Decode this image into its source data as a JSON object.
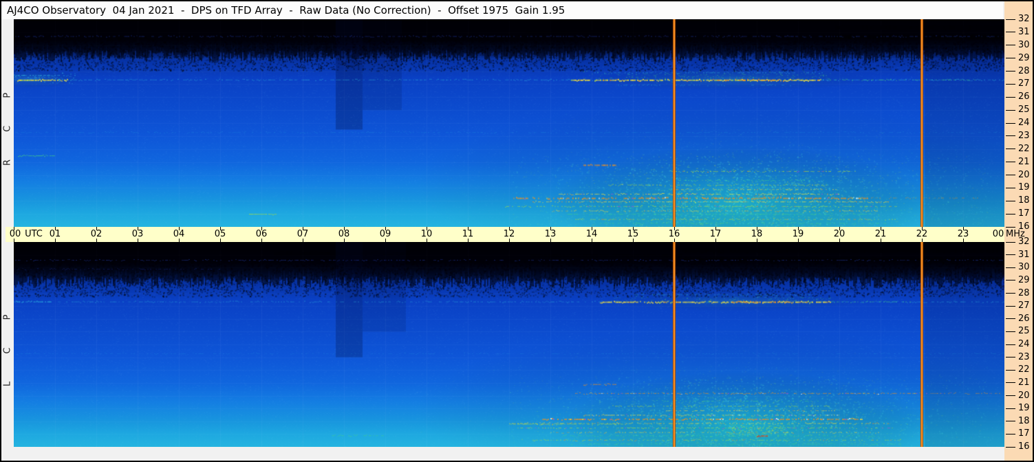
{
  "title": "AJ4CO Observatory  04 Jan 2021  -  DPS on TFD Array  -  Raw Data (No Correction)  -  Offset 1975  Gain 1.95",
  "time_axis": {
    "unit_label": "UTC",
    "right_unit": "MHz",
    "hours": [
      "00",
      "01",
      "02",
      "03",
      "04",
      "05",
      "06",
      "07",
      "08",
      "09",
      "10",
      "11",
      "12",
      "13",
      "14",
      "15",
      "16",
      "17",
      "18",
      "19",
      "20",
      "21",
      "22",
      "23",
      "00"
    ]
  },
  "freq_axis": {
    "unit": "MHz",
    "ticks": [
      32,
      31,
      30,
      29,
      28,
      27,
      26,
      25,
      24,
      23,
      22,
      21,
      20,
      19,
      18,
      17,
      16
    ]
  },
  "colors": {
    "chrome_bg": "#f1f1f1",
    "titlebar_bg": "#fcfcfc",
    "time_axis_bg": "#ffffc9",
    "freq_axis_bg": "#fbdab4",
    "border": "#000000",
    "marker_center": "#ff9726",
    "marker_edge": "#a34700"
  },
  "chart_data": {
    "type": "heatmap",
    "title": "AJ4CO Observatory 04 Jan 2021 - DPS on TFD Array - Raw Data (No Correction)",
    "date": "04 Jan 2021",
    "offset": 1975,
    "gain": 1.95,
    "x_axis": {
      "label": "UTC",
      "range_hours": [
        0,
        24
      ],
      "tick_interval_hours": 1
    },
    "y_axis": {
      "label": "MHz",
      "range_mhz": [
        16,
        32
      ],
      "tick_interval_mhz": 1,
      "direction": "up"
    },
    "marker_lines": {
      "times_utc": [
        16,
        22
      ]
    },
    "palette": {
      "blue": "#2847d8",
      "cyan": "#38d8e8",
      "green": "#48dc78",
      "yellowgreen": "#aade3c",
      "yellow": "#f0dc3a",
      "orange": "#f09020",
      "red": "#e03818",
      "magenta": "#b84cc8",
      "white": "#f8f8f0"
    },
    "base_gradient": [
      [
        32,
        "#000002"
      ],
      [
        30.4,
        "#000210"
      ],
      [
        29.7,
        "#031448"
      ],
      [
        28.9,
        "#0631a4"
      ],
      [
        27.5,
        "#0a40c4"
      ],
      [
        25,
        "#0c4ccf"
      ],
      [
        23,
        "#0e56d8"
      ],
      [
        21,
        "#1066de"
      ],
      [
        19.5,
        "#147ee2"
      ],
      [
        18,
        "#1896de"
      ],
      [
        17,
        "#1ea8e0"
      ],
      [
        16,
        "#25b4e0"
      ]
    ],
    "panels": [
      {
        "polarization": "RCP",
        "label": "R C P",
        "dark_f": 29.15,
        "noise_center": {
          "t": 17.6,
          "f": 18.2,
          "rt": 3.6,
          "rf": 3.4
        },
        "band_boost": {
          "t0": 12,
          "t1": 23.6,
          "fmax": 21.5,
          "w": 0.16
        },
        "glows": [
          {
            "t": 17.6,
            "f": 17.9,
            "rt": 4.6,
            "rf": 4.4,
            "c": "rgba(40,225,170,0.30)"
          },
          {
            "t": 17.3,
            "f": 19.2,
            "rt": 7.6,
            "rf": 6.5,
            "c": "rgba(25,185,215,0.17)"
          },
          {
            "t": 17.4,
            "f": 27.4,
            "rt": 3.6,
            "rf": 0.9,
            "c": "rgba(70,215,130,0.18)"
          },
          {
            "t": 0.4,
            "f": 27.4,
            "rt": 1.3,
            "rf": 0.7,
            "c": "rgba(70,215,215,0.22)"
          }
        ],
        "bands": [
          {
            "f": 31.35,
            "t0": 19.9,
            "t1": 24,
            "h": 6,
            "a": 0.85
          },
          {
            "f": 30.65,
            "t0": 19.9,
            "t1": 24,
            "h": 6,
            "a": 0.75
          },
          {
            "f": 31.0,
            "t0": 12.4,
            "t1": 16.2,
            "h": 5,
            "a": 0.45
          },
          {
            "f": 30.4,
            "t0": 7.8,
            "t1": 12.4,
            "h": 4,
            "a": 0.35
          }
        ],
        "cols": [
          {
            "t0": 7.8,
            "t1": 8.45,
            "f0": 23.5,
            "f1": 32,
            "a": 0.26
          },
          {
            "t0": 8.45,
            "t1": 9.4,
            "f0": 25,
            "f1": 32,
            "a": 0.13
          },
          {
            "t0": 22.07,
            "t1": 24,
            "f0": 16,
            "f1": 29.5,
            "a": 0.14
          }
        ],
        "blobs": [
          {
            "f": 27.5,
            "df": 0.45,
            "t0": 0,
            "t1": 1.5,
            "c": "cyan",
            "d": 0.45,
            "a": 0.5
          },
          {
            "f": 27.6,
            "df": 0.5,
            "t0": 13.8,
            "t1": 19.8,
            "c": "green",
            "d": 0.4,
            "a": 0.4
          },
          {
            "f": 18.5,
            "df": 2.3,
            "t0": 15.8,
            "t1": 19.8,
            "c": "green",
            "d": 0.25,
            "a": 0.28
          }
        ],
        "lines": [
          {
            "f": 30.7,
            "t0": 0,
            "t1": 24,
            "c": "blue",
            "a": 0.45,
            "seg": 0.55,
            "w": 1
          },
          {
            "f": 27.35,
            "t0": 0,
            "t1": 24,
            "c": "cyan",
            "a": 0.45,
            "seg": 0.6,
            "w": 1
          },
          {
            "f": 27.35,
            "t0": 0.05,
            "t1": 1.3,
            "c": "yellow",
            "a": 0.95,
            "seg": 0.9,
            "w": 2,
            "acc": [
              "yellowgreen",
              "cyan"
            ]
          },
          {
            "f": 27.7,
            "t0": 0.05,
            "t1": 1.1,
            "c": "cyan",
            "a": 0.6,
            "seg": 0.6,
            "w": 1
          },
          {
            "f": 27.35,
            "t0": 13.5,
            "t1": 19.6,
            "c": "yellow",
            "a": 0.95,
            "seg": 0.9,
            "w": 2,
            "acc": [
              "orange",
              "yellowgreen"
            ]
          },
          {
            "f": 27.35,
            "t0": 16.9,
            "t1": 18.6,
            "c": "orange",
            "a": 0.85,
            "seg": 0.6,
            "w": 2
          },
          {
            "f": 27.35,
            "t0": 19.6,
            "t1": 23.3,
            "c": "green",
            "a": 0.6,
            "seg": 0.6,
            "w": 1,
            "acc": [
              "cyan"
            ]
          },
          {
            "f": 27.9,
            "t0": 14,
            "t1": 19.6,
            "c": "cyan",
            "a": 0.45,
            "seg": 0.5,
            "w": 1
          },
          {
            "f": 26.95,
            "t0": 14.5,
            "t1": 19,
            "c": "cyan",
            "a": 0.35,
            "seg": 0.4,
            "w": 1
          },
          {
            "f": 23.3,
            "t0": 0,
            "t1": 24,
            "c": "cyan",
            "a": 0.18,
            "seg": 0.5,
            "w": 1
          },
          {
            "f": 21.5,
            "t0": 0.1,
            "t1": 1.0,
            "c": "green",
            "a": 0.75,
            "seg": 0.85,
            "w": 1
          },
          {
            "f": 20.8,
            "t0": 13.8,
            "t1": 14.6,
            "c": "orange",
            "a": 0.9,
            "seg": 0.9,
            "w": 2
          },
          {
            "f": 20.3,
            "t0": 15.9,
            "t1": 20.4,
            "c": "yellowgreen",
            "a": 0.8,
            "seg": 0.65,
            "w": 1,
            "acc": [
              "orange",
              "magenta"
            ]
          },
          {
            "f": 19.6,
            "t0": 16.1,
            "t1": 19.4,
            "c": "green",
            "a": 0.55,
            "seg": 0.5,
            "w": 1
          },
          {
            "f": 19.25,
            "t0": 14.4,
            "t1": 19.7,
            "c": "yellowgreen",
            "a": 0.7,
            "seg": 0.6,
            "w": 1,
            "acc": [
              "yellow"
            ]
          },
          {
            "f": 18.9,
            "t0": 16,
            "t1": 20,
            "c": "yellow",
            "a": 0.75,
            "seg": 0.6,
            "w": 1,
            "acc": [
              "orange"
            ]
          },
          {
            "f": 18.55,
            "t0": 13.2,
            "t1": 20,
            "c": "yellow",
            "a": 0.85,
            "seg": 0.7,
            "w": 1,
            "acc": [
              "orange",
              "magenta"
            ]
          },
          {
            "f": 18.25,
            "t0": 12.1,
            "t1": 20.7,
            "c": "orange",
            "a": 0.85,
            "seg": 0.7,
            "w": 2,
            "acc": [
              "yellow",
              "magenta",
              "white"
            ]
          },
          {
            "f": 18.25,
            "t0": 20.7,
            "t1": 23.4,
            "c": "orange",
            "a": 0.5,
            "seg": 0.4,
            "w": 1
          },
          {
            "f": 18.4,
            "t0": 17.5,
            "t1": 18.6,
            "c": "red",
            "a": 0.6,
            "seg": 0.35,
            "w": 1
          },
          {
            "f": 17.95,
            "t0": 12.4,
            "t1": 21.2,
            "c": "yellow",
            "a": 0.8,
            "seg": 0.65,
            "w": 1,
            "acc": [
              "orange"
            ]
          },
          {
            "f": 17.6,
            "t0": 11.9,
            "t1": 21.4,
            "c": "yellowgreen",
            "a": 0.75,
            "seg": 0.6,
            "w": 1,
            "acc": [
              "magenta",
              "orange"
            ]
          },
          {
            "f": 17.25,
            "t0": 13,
            "t1": 21,
            "c": "yellow",
            "a": 0.7,
            "seg": 0.55,
            "w": 1,
            "acc": [
              "orange"
            ]
          },
          {
            "f": 17.0,
            "t0": 5.7,
            "t1": 6.35,
            "c": "yellowgreen",
            "a": 0.85,
            "seg": 0.9,
            "w": 1
          },
          {
            "f": 17.0,
            "t0": 13.4,
            "t1": 21,
            "c": "green",
            "a": 0.55,
            "seg": 0.5,
            "w": 1
          },
          {
            "f": 16.6,
            "t0": 13.6,
            "t1": 21.5,
            "c": "yellowgreen",
            "a": 0.7,
            "seg": 0.55,
            "w": 1,
            "acc": [
              "orange"
            ]
          },
          {
            "f": 16.3,
            "t0": 14.2,
            "t1": 21.2,
            "c": "green",
            "a": 0.55,
            "seg": 0.5,
            "w": 1
          }
        ]
      },
      {
        "polarization": "LCP",
        "label": "L C P",
        "dark_f": 28.85,
        "noise_center": {
          "t": 17.7,
          "f": 17.9,
          "rt": 3.5,
          "rf": 3.2
        },
        "band_boost": {
          "t0": 12,
          "t1": 23.6,
          "fmax": 21.5,
          "w": 0.15
        },
        "glows": [
          {
            "t": 17.7,
            "f": 17.7,
            "rt": 4.4,
            "rf": 4.2,
            "c": "rgba(40,225,170,0.30)"
          },
          {
            "t": 17.3,
            "f": 19.0,
            "rt": 7.6,
            "rf": 6.3,
            "c": "rgba(25,185,215,0.16)"
          },
          {
            "t": 17.5,
            "f": 27.4,
            "rt": 3.2,
            "rf": 0.8,
            "c": "rgba(70,215,130,0.15)"
          }
        ],
        "bands": [
          {
            "f": 31.35,
            "t0": 16.2,
            "t1": 24,
            "h": 6,
            "a": 0.8
          },
          {
            "f": 30.65,
            "t0": 16.2,
            "t1": 24,
            "h": 5,
            "a": 0.7
          },
          {
            "f": 31.1,
            "t0": 6.3,
            "t1": 9.6,
            "h": 5,
            "a": 0.45
          },
          {
            "f": 30.9,
            "t0": 12.5,
            "t1": 16.2,
            "h": 4,
            "a": 0.4
          }
        ],
        "cols": [
          {
            "t0": 7.8,
            "t1": 8.45,
            "f0": 23,
            "f1": 32,
            "a": 0.24
          },
          {
            "t0": 8.45,
            "t1": 9.5,
            "f0": 25,
            "f1": 32,
            "a": 0.12
          },
          {
            "t0": 22.07,
            "t1": 24,
            "f0": 16,
            "f1": 29.5,
            "a": 0.12
          }
        ],
        "blobs": [
          {
            "f": 27.5,
            "df": 0.4,
            "t0": 14.5,
            "t1": 19.8,
            "c": "green",
            "d": 0.35,
            "a": 0.35
          },
          {
            "f": 17.4,
            "df": 0.6,
            "t0": 17.3,
            "t1": 18.8,
            "c": "yellowgreen",
            "d": 0.8,
            "a": 0.6
          },
          {
            "f": 18.3,
            "df": 2.2,
            "t0": 15.5,
            "t1": 19.8,
            "c": "green",
            "d": 0.22,
            "a": 0.25
          }
        ],
        "lines": [
          {
            "f": 30.6,
            "t0": 0,
            "t1": 24,
            "c": "blue",
            "a": 0.45,
            "seg": 0.5,
            "w": 1
          },
          {
            "f": 29.9,
            "t0": 0,
            "t1": 5,
            "c": "blue",
            "a": 0.3,
            "seg": 0.4,
            "w": 1
          },
          {
            "f": 27.35,
            "t0": 0,
            "t1": 24,
            "c": "cyan",
            "a": 0.4,
            "seg": 0.55,
            "w": 1
          },
          {
            "f": 27.35,
            "t0": 0.05,
            "t1": 0.9,
            "c": "cyan",
            "a": 0.7,
            "seg": 0.8,
            "w": 1
          },
          {
            "f": 27.35,
            "t0": 14.2,
            "t1": 19.8,
            "c": "yellow",
            "a": 0.9,
            "seg": 0.85,
            "w": 2,
            "acc": [
              "orange",
              "yellowgreen"
            ]
          },
          {
            "f": 27.35,
            "t0": 17.4,
            "t1": 18.9,
            "c": "orange",
            "a": 0.8,
            "seg": 0.55,
            "w": 2
          },
          {
            "f": 27.35,
            "t0": 19.8,
            "t1": 21.8,
            "c": "green",
            "a": 0.55,
            "seg": 0.55,
            "w": 1
          },
          {
            "f": 27.9,
            "t0": 15,
            "t1": 19.3,
            "c": "cyan",
            "a": 0.4,
            "seg": 0.45,
            "w": 1
          },
          {
            "f": 23.3,
            "t0": 0,
            "t1": 24,
            "c": "cyan",
            "a": 0.15,
            "seg": 0.45,
            "w": 1
          },
          {
            "f": 20.9,
            "t0": 13.8,
            "t1": 14.6,
            "c": "orange",
            "a": 0.85,
            "seg": 0.85,
            "w": 1
          },
          {
            "f": 20.2,
            "t0": 13.6,
            "t1": 21.9,
            "c": "orange",
            "a": 0.8,
            "seg": 0.6,
            "w": 1,
            "acc": [
              "magenta",
              "yellow",
              "white"
            ]
          },
          {
            "f": 20.2,
            "t0": 21.9,
            "t1": 23.9,
            "c": "orange",
            "a": 0.55,
            "seg": 0.45,
            "w": 1,
            "acc": [
              "magenta"
            ]
          },
          {
            "f": 19.6,
            "t0": 15.5,
            "t1": 19.5,
            "c": "green",
            "a": 0.5,
            "seg": 0.45,
            "w": 1
          },
          {
            "f": 19.2,
            "t0": 14.5,
            "t1": 19.8,
            "c": "yellowgreen",
            "a": 0.65,
            "seg": 0.55,
            "w": 1
          },
          {
            "f": 18.85,
            "t0": 15.8,
            "t1": 20,
            "c": "yellow",
            "a": 0.7,
            "seg": 0.55,
            "w": 1,
            "acc": [
              "orange"
            ]
          },
          {
            "f": 18.5,
            "t0": 13.8,
            "t1": 20,
            "c": "yellow",
            "a": 0.8,
            "seg": 0.65,
            "w": 1,
            "acc": [
              "orange",
              "magenta",
              "white"
            ]
          },
          {
            "f": 18.2,
            "t0": 12.8,
            "t1": 20.6,
            "c": "orange",
            "a": 0.8,
            "seg": 0.65,
            "w": 2,
            "acc": [
              "yellow",
              "magenta",
              "white"
            ]
          },
          {
            "f": 17.85,
            "t0": 12,
            "t1": 21.2,
            "c": "yellow",
            "a": 0.75,
            "seg": 0.6,
            "w": 1,
            "acc": [
              "orange"
            ]
          },
          {
            "f": 17.8,
            "t0": 12,
            "t1": 14.8,
            "c": "yellowgreen",
            "a": 0.7,
            "seg": 0.7,
            "w": 1
          },
          {
            "f": 17.5,
            "t0": 12.2,
            "t1": 21.3,
            "c": "yellowgreen",
            "a": 0.7,
            "seg": 0.55,
            "w": 1,
            "acc": [
              "magenta"
            ]
          },
          {
            "f": 17.15,
            "t0": 13,
            "t1": 21,
            "c": "yellow",
            "a": 0.65,
            "seg": 0.5,
            "w": 1,
            "acc": [
              "orange"
            ]
          },
          {
            "f": 16.9,
            "t0": 7.7,
            "t1": 9.0,
            "c": "green",
            "a": 0.55,
            "seg": 0.6,
            "w": 1
          },
          {
            "f": 16.9,
            "t0": 13.3,
            "t1": 21,
            "c": "green",
            "a": 0.5,
            "seg": 0.5,
            "w": 1
          },
          {
            "f": 16.9,
            "t0": 18.0,
            "t1": 18.25,
            "c": "red",
            "a": 0.9,
            "seg": 1,
            "w": 2
          },
          {
            "f": 16.55,
            "t0": 12.3,
            "t1": 21.5,
            "c": "yellowgreen",
            "a": 0.65,
            "seg": 0.55,
            "w": 1,
            "acc": [
              "orange"
            ]
          },
          {
            "f": 16.25,
            "t0": 13.5,
            "t1": 21.5,
            "c": "green",
            "a": 0.5,
            "seg": 0.45,
            "w": 1
          }
        ]
      }
    ]
  }
}
